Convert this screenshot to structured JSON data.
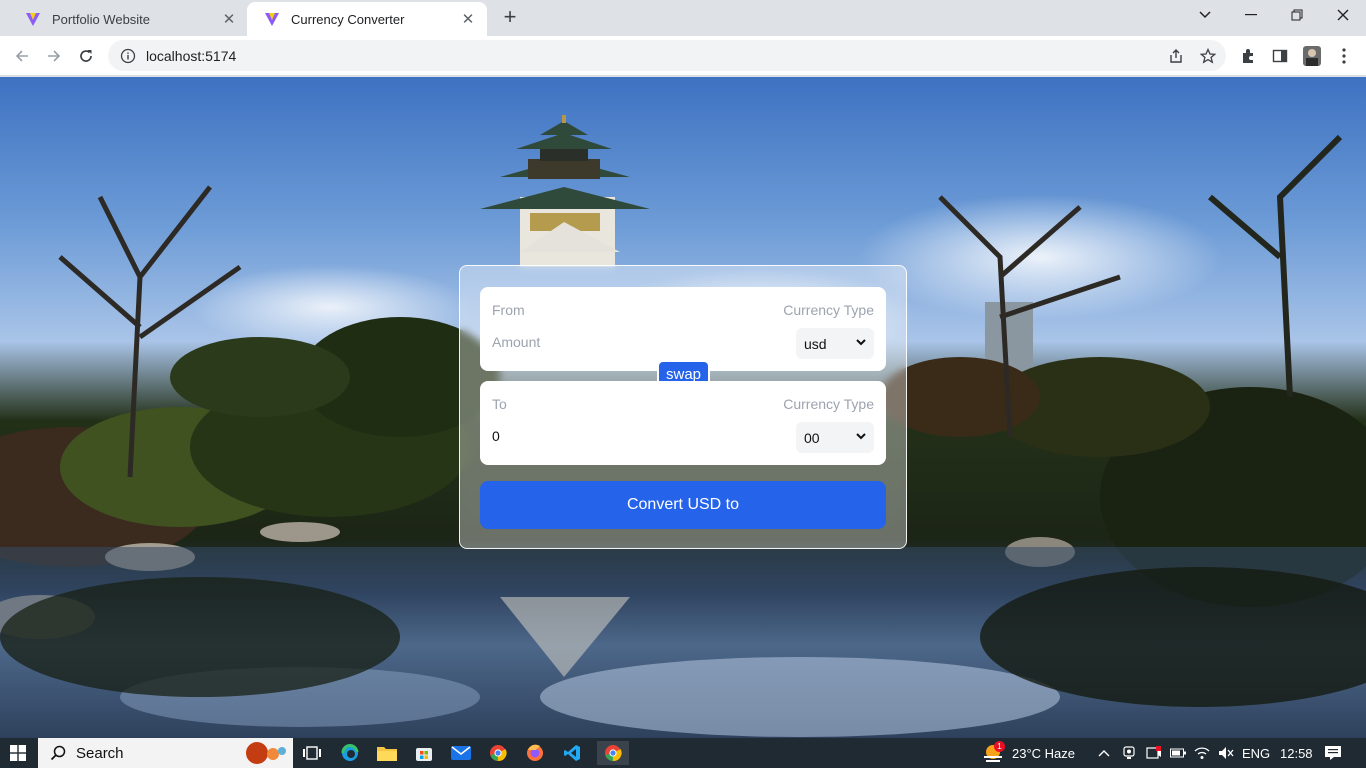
{
  "browser": {
    "tabs": [
      {
        "title": "Portfolio Website",
        "active": false
      },
      {
        "title": "Currency Converter",
        "active": true
      }
    ],
    "address": "localhost:5174"
  },
  "converter": {
    "from": {
      "label": "From",
      "currency_type_label": "Currency Type",
      "amount_placeholder": "Amount",
      "currency": "usd"
    },
    "swap_label": "swap",
    "to": {
      "label": "To",
      "currency_type_label": "Currency Type",
      "amount": "0",
      "currency": "00"
    },
    "convert_label": "Convert USD to"
  },
  "taskbar": {
    "search_label": "Search",
    "weather": "23°C Haze",
    "language": "ENG",
    "time": "12:58",
    "weather_badge": "1"
  },
  "colors": {
    "accent": "#2563eb",
    "taskbar": "#1f2a33"
  }
}
